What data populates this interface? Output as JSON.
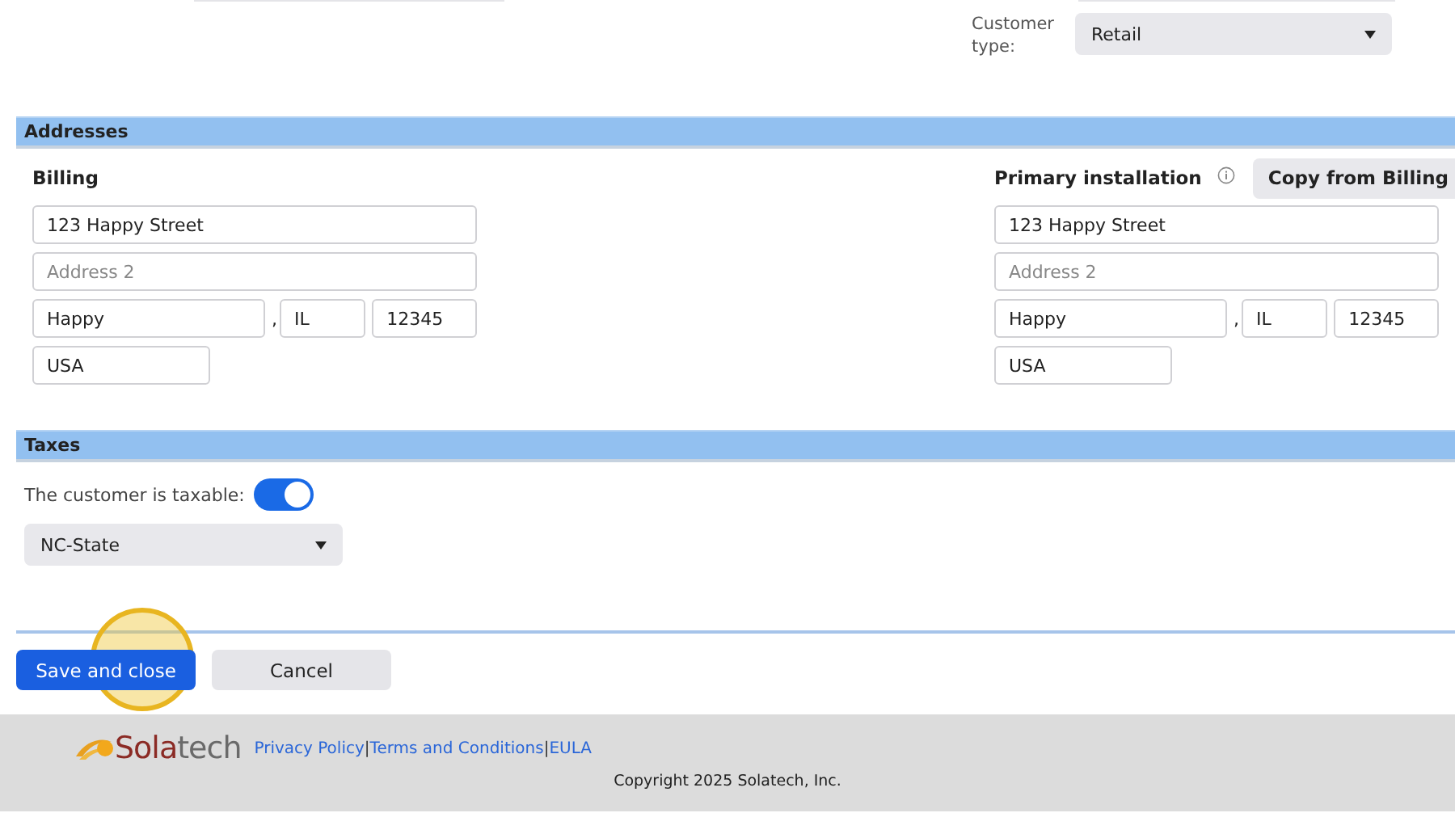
{
  "customer_type": {
    "label": "Customer type:",
    "value": "Retail"
  },
  "addresses": {
    "title": "Addresses",
    "billing": {
      "title": "Billing",
      "address1": "123 Happy Street",
      "address2_placeholder": "Address 2",
      "city": "Happy",
      "separator": ",",
      "state": "IL",
      "zip": "12345",
      "country": "USA"
    },
    "primary_installation": {
      "title": "Primary installation",
      "copy_button": "Copy from Billing",
      "address1": "123 Happy Street",
      "address2_placeholder": "Address 2",
      "city": "Happy",
      "separator": ",",
      "state": "IL",
      "zip": "12345",
      "country": "USA"
    }
  },
  "taxes": {
    "title": "Taxes",
    "taxable_label": "The customer is taxable:",
    "taxable": true,
    "tax_region": "NC-State"
  },
  "buttons": [
    {
      "label": "Save and close",
      "kind": "primary"
    },
    {
      "label": "Cancel",
      "kind": "secondary"
    }
  ],
  "footer": {
    "logo": {
      "first": "Sola",
      "second": "tech"
    },
    "links": [
      "Privacy Policy",
      "Terms and Conditions",
      "EULA"
    ],
    "link_separator": "|",
    "copyright": "Copyright 2025 Solatech, Inc."
  }
}
